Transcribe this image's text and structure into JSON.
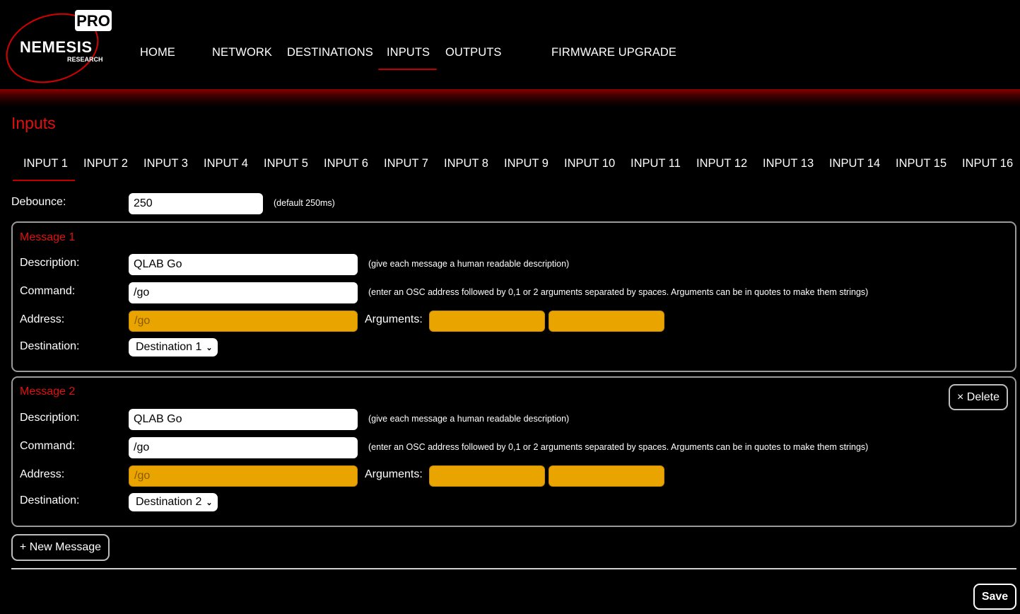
{
  "brand": {
    "logo_main": "NEMESIS",
    "logo_sub": "RESEARCH",
    "logo_badge": "PRO"
  },
  "nav": {
    "home": "HOME",
    "network": "NETWORK",
    "destinations": "DESTINATIONS",
    "inputs": "INPUTS",
    "outputs": "OUTPUTS",
    "firmware": "FIRMWARE UPGRADE",
    "active": "INPUTS"
  },
  "page": {
    "title": "Inputs"
  },
  "tabs": [
    "INPUT 1",
    "INPUT 2",
    "INPUT 3",
    "INPUT 4",
    "INPUT 5",
    "INPUT 6",
    "INPUT 7",
    "INPUT 8",
    "INPUT 9",
    "INPUT 10",
    "INPUT 11",
    "INPUT 12",
    "INPUT 13",
    "INPUT 14",
    "INPUT 15",
    "INPUT 16"
  ],
  "active_tab": "INPUT 1",
  "debounce": {
    "label": "Debounce:",
    "value": "250",
    "hint": "(default 250ms)"
  },
  "labels": {
    "description": "Description:",
    "command": "Command:",
    "address": "Address:",
    "arguments": "Arguments:",
    "destination": "Destination:",
    "description_hint": "(give each message a human readable description)",
    "command_hint": "(enter an OSC address followed by 0,1 or 2 arguments separated by spaces. Arguments can be in quotes to make them strings)"
  },
  "messages": [
    {
      "title": "Message 1",
      "description": "QLAB Go",
      "command": "/go",
      "address": "/go",
      "arg1": "",
      "arg2": "",
      "destination": "Destination 1"
    },
    {
      "title": "Message 2",
      "description": "QLAB Go",
      "command": "/go",
      "address": "/go",
      "arg1": "",
      "arg2": "",
      "destination": "Destination 2",
      "delete_label": "× Delete"
    }
  ],
  "buttons": {
    "new_message": "+ New Message",
    "save": "Save"
  },
  "colors": {
    "accent": "#e01010",
    "address_field": "#e9a400",
    "background": "#000000"
  }
}
